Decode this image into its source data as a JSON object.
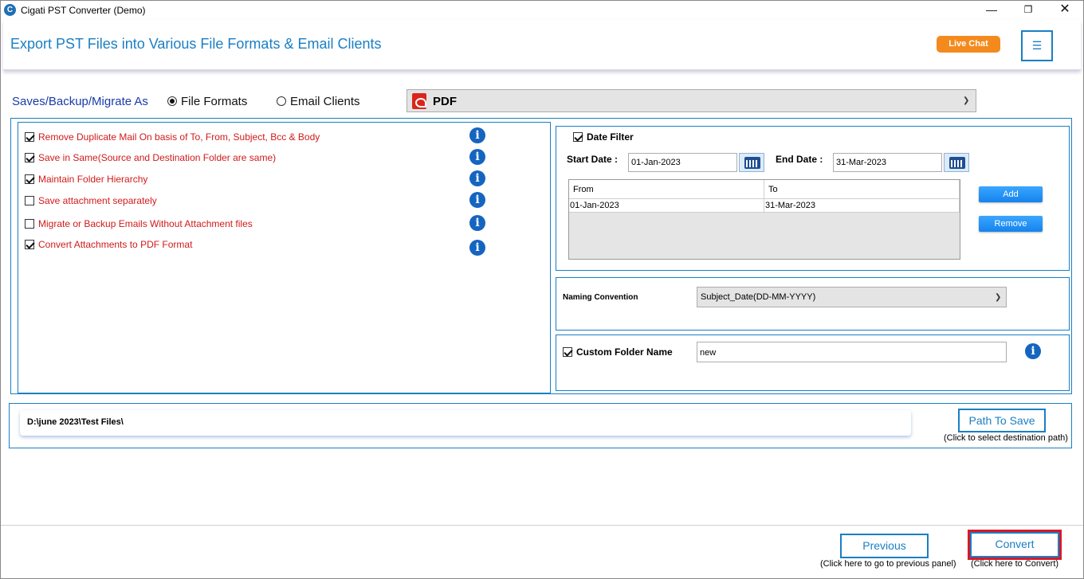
{
  "window": {
    "title": "Cigati PST Converter (Demo)",
    "controls": {
      "minimize": "—",
      "maximize": "❐",
      "close": "✕"
    }
  },
  "banner": {
    "title": "Export PST Files into Various File Formats & Email Clients",
    "live_chat": "Live Chat",
    "menu_icon": "☰"
  },
  "save_as": {
    "label": "Saves/Backup/Migrate As",
    "options": [
      {
        "label": "File Formats",
        "selected": true
      },
      {
        "label": "Email Clients",
        "selected": false
      }
    ],
    "format": "PDF"
  },
  "options": [
    {
      "label": "Remove Duplicate Mail On basis of To, From, Subject, Bcc & Body",
      "checked": true
    },
    {
      "label": "Save in Same(Source and Destination Folder are same)",
      "checked": true
    },
    {
      "label": "Maintain Folder Hierarchy",
      "checked": true
    },
    {
      "label": "Save attachment separately",
      "checked": false
    },
    {
      "label": "Migrate or Backup Emails Without Attachment files",
      "checked": false
    },
    {
      "label": "Convert Attachments to PDF Format",
      "checked": true
    }
  ],
  "date_filter": {
    "label": "Date Filter",
    "checked": true,
    "start_label": "Start Date :",
    "start_value": "01-Jan-2023",
    "end_label": "End Date :",
    "end_value": "31-Mar-2023",
    "table": {
      "headers": [
        "From",
        "To"
      ],
      "rows": [
        [
          "01-Jan-2023",
          "31-Mar-2023"
        ]
      ]
    },
    "add_label": "Add",
    "remove_label": "Remove"
  },
  "naming": {
    "label": "Naming Convention",
    "value": "Subject_Date(DD-MM-YYYY)"
  },
  "custom_folder": {
    "label": "Custom Folder Name",
    "checked": true,
    "value": "new"
  },
  "path": {
    "value": "D:\\june 2023\\Test Files\\",
    "button": "Path To Save",
    "hint": "(Click to select destination path)"
  },
  "footer": {
    "previous": "Previous",
    "previous_hint": "(Click here to go to previous panel)",
    "convert": "Convert",
    "convert_hint": "(Click here to Convert)"
  },
  "colors": {
    "accent": "#1a7fc4",
    "option_text": "#d11a1a",
    "live_chat": "#f48a1d",
    "convert_highlight": "#d61a2a"
  }
}
